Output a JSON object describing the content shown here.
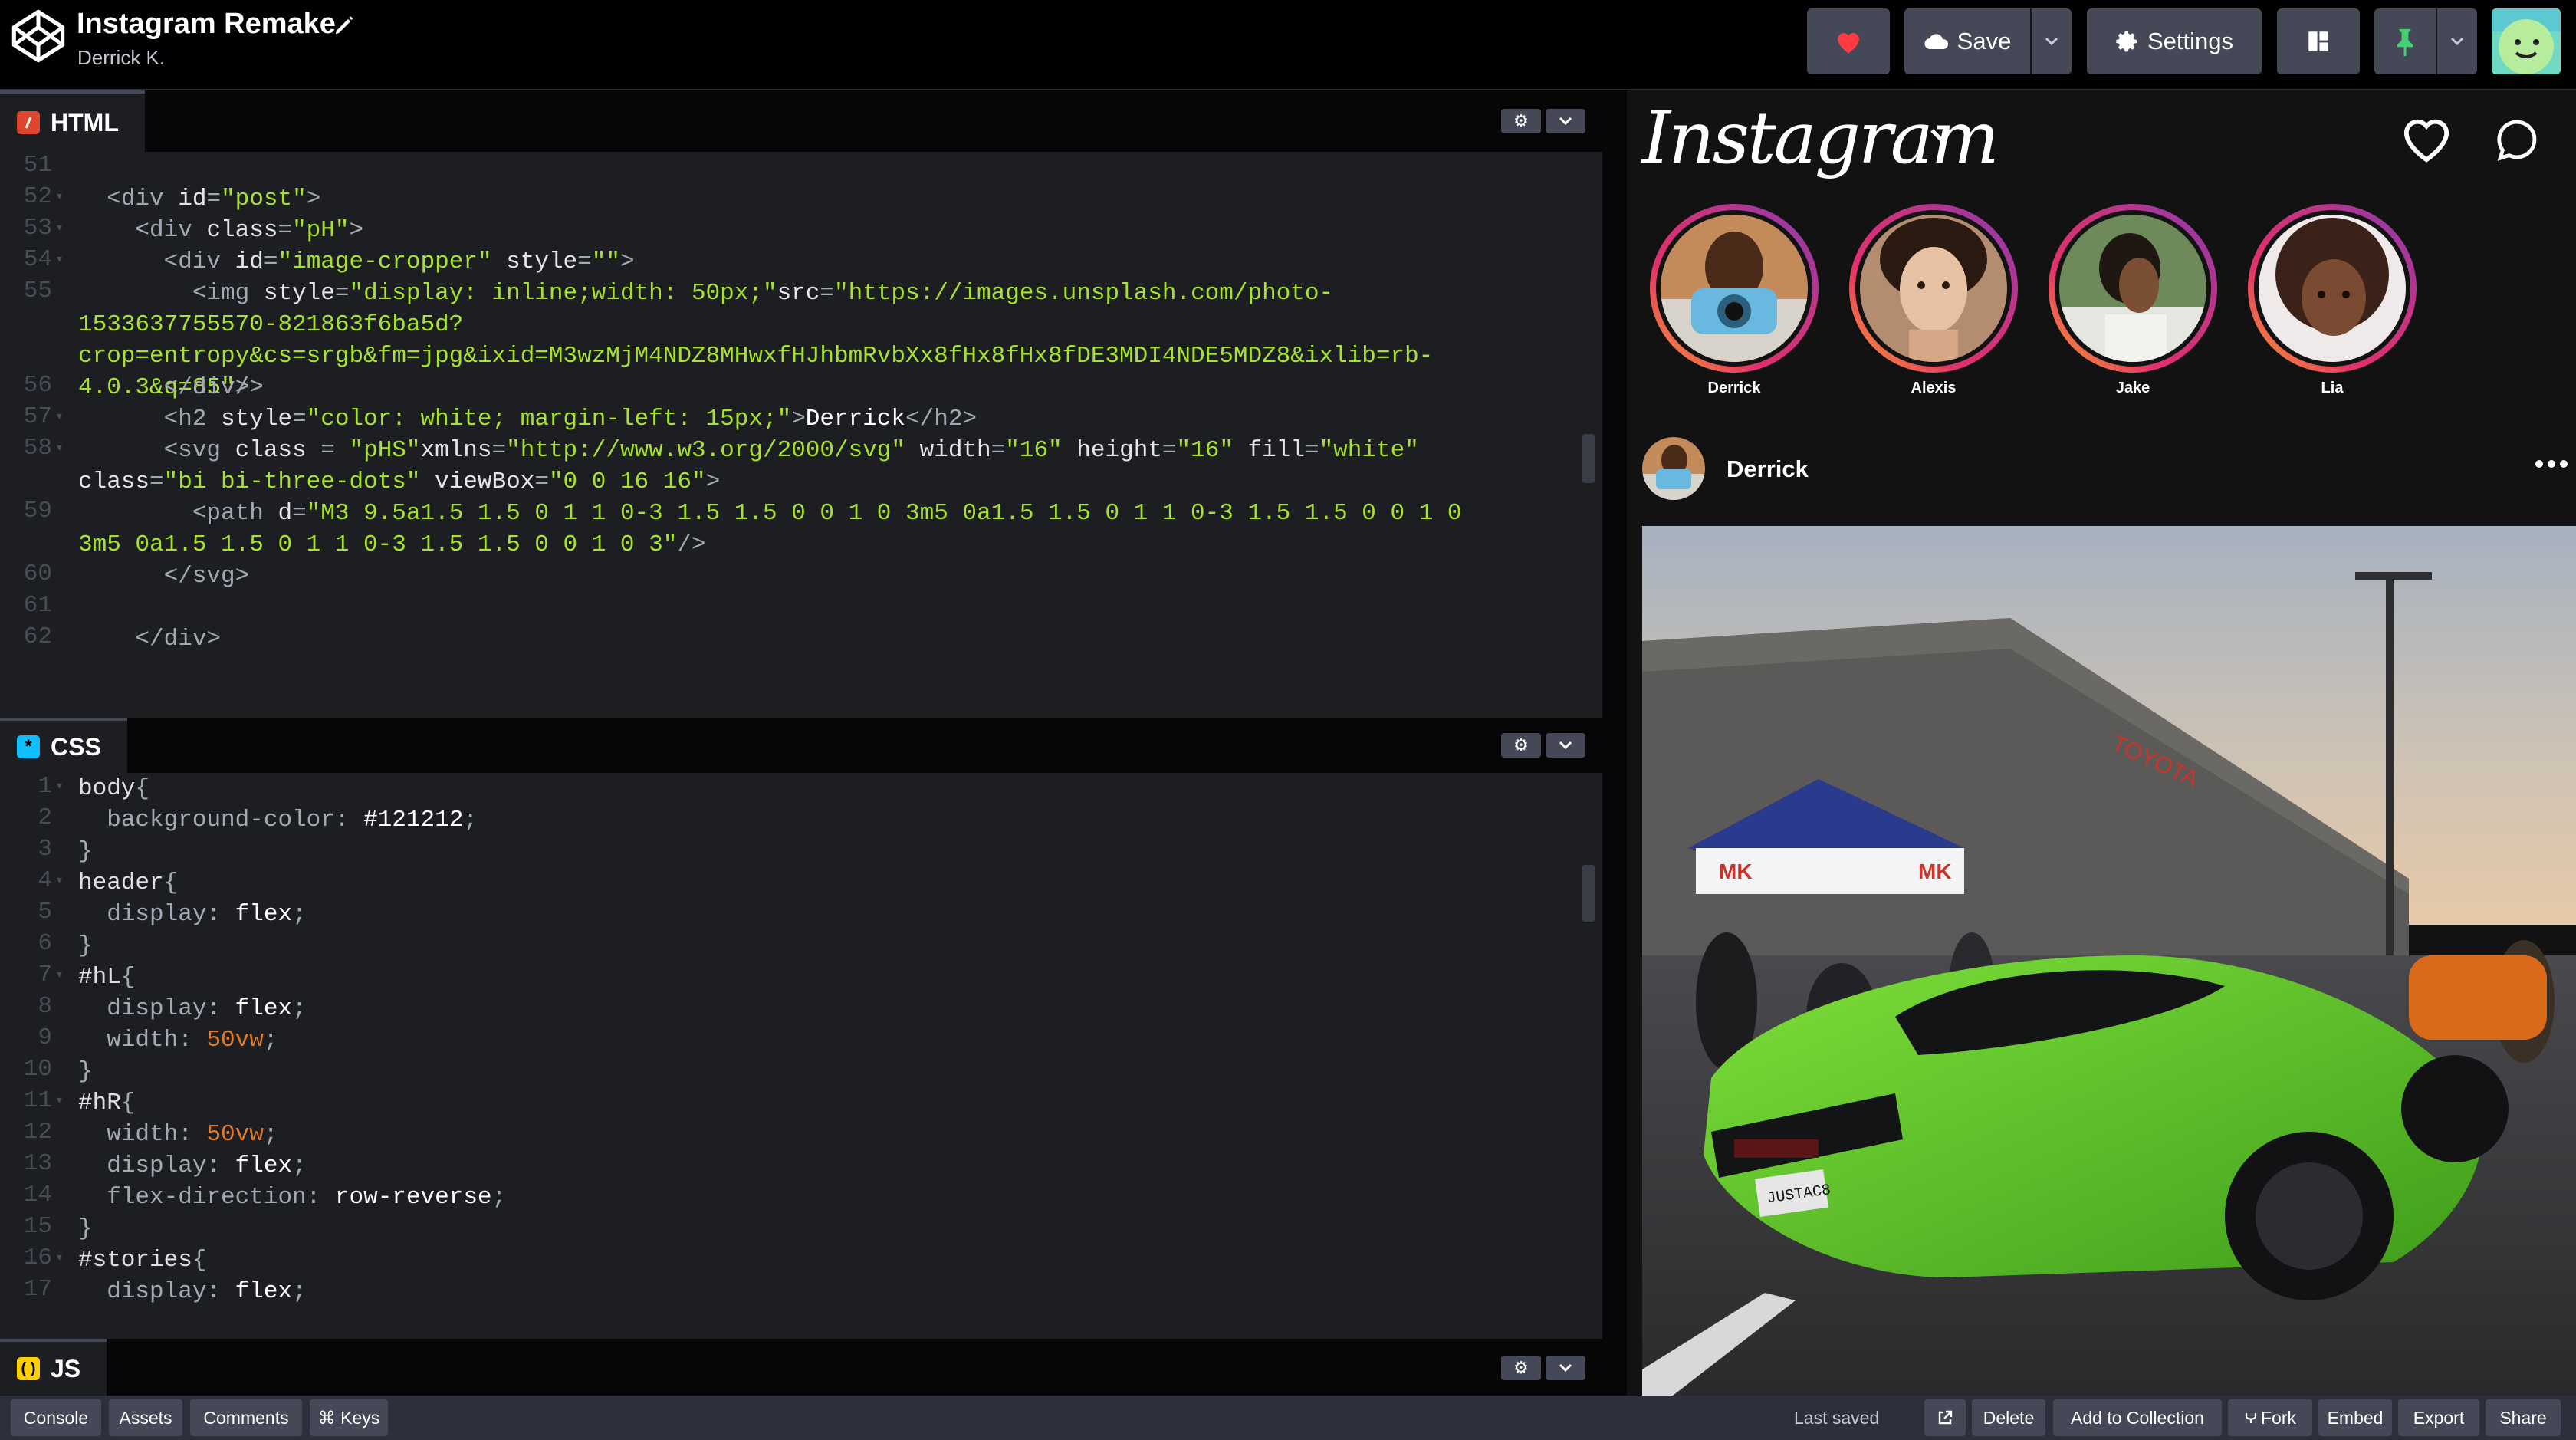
{
  "app": {
    "pen_title": "Instagram Remake",
    "author": "Derrick K."
  },
  "toolbar": {
    "save_label": "Save",
    "settings_label": "Settings"
  },
  "panels": {
    "html": {
      "label": "HTML"
    },
    "css": {
      "label": "CSS"
    },
    "js": {
      "label": "JS"
    }
  },
  "html_code": [
    {
      "n": "51",
      "fold": false,
      "html": ""
    },
    {
      "n": "52",
      "fold": true,
      "html": "  <span class='t-tag'>&lt;div</span> <span class='t-attr'>id</span>=<span class='t-val'>\"post\"</span><span class='t-tag'>&gt;</span>"
    },
    {
      "n": "53",
      "fold": true,
      "html": "    <span class='t-tag'>&lt;div</span> <span class='t-attr'>class</span>=<span class='t-val'>\"pH\"</span><span class='t-tag'>&gt;</span>"
    },
    {
      "n": "54",
      "fold": true,
      "html": "      <span class='t-tag'>&lt;div</span> <span class='t-attr'>id</span>=<span class='t-val'>\"image-cropper\"</span> <span class='t-attr'>style</span>=<span class='t-val'>\"\"</span><span class='t-tag'>&gt;</span>"
    },
    {
      "n": "55",
      "fold": false,
      "html": "        <span class='t-tag'>&lt;img</span> <span class='t-attr'>style</span>=<span class='t-val'>\"display: inline;width: 50px;\"</span><span class='t-attr'>src</span>=<span class='t-val'>\"https://images.unsplash.com/photo-1533637755570-821863f6ba5d?crop=entropy&amp;cs=srgb&amp;fm=jpg&amp;ixid=M3wzMjM4NDZ8MHwxfHJhbmRvbXx8fHx8fHx8fDE3MDI4NDE5MDZ8&amp;ixlib=rb-4.0.3&amp;q=85\"</span><span class='t-tag'>/&gt;</span>",
      "rows": 3
    },
    {
      "n": "56",
      "fold": false,
      "html": "      <span class='t-tag'>&lt;/div&gt;</span>"
    },
    {
      "n": "57",
      "fold": true,
      "html": "      <span class='t-tag'>&lt;h2</span> <span class='t-attr'>style</span>=<span class='t-val'>\"color: white; margin-left: 15px;\"</span><span class='t-tag'>&gt;</span><span class='t-plain'>Derrick</span><span class='t-tag'>&lt;/h2&gt;</span>"
    },
    {
      "n": "58",
      "fold": true,
      "html": "      <span class='t-tag'>&lt;svg</span> <span class='t-attr'>class</span> = <span class='t-val'>\"pHS\"</span><span class='t-attr'>xmlns</span>=<span class='t-val'>\"http://www.w3.org/2000/svg\"</span> <span class='t-attr'>width</span>=<span class='t-val'>\"16\"</span> <span class='t-attr'>height</span>=<span class='t-val'>\"16\"</span> <span class='t-attr'>fill</span>=<span class='t-val'>\"white\"</span> <span class='t-attr'>class</span>=<span class='t-val'>\"bi bi-three-dots\"</span> <span class='t-attr'>viewBox</span>=<span class='t-val'>\"0 0 16 16\"</span><span class='t-tag'>&gt;</span>",
      "rows": 2
    },
    {
      "n": "59",
      "fold": false,
      "html": "        <span class='t-tag'>&lt;path</span> <span class='t-attr'>d</span>=<span class='t-val'>\"M3 9.5a1.5 1.5 0 1 1 0-3 1.5 1.5 0 0 1 0 3m5 0a1.5 1.5 0 1 1 0-3 1.5 1.5 0 0 1 0 3m5 0a1.5 1.5 0 1 1 0-3 1.5 1.5 0 0 1 0 3\"</span><span class='t-tag'>/&gt;</span>",
      "rows": 2
    },
    {
      "n": "60",
      "fold": false,
      "html": "      <span class='t-tag'>&lt;/svg&gt;</span>"
    },
    {
      "n": "61",
      "fold": false,
      "html": ""
    },
    {
      "n": "62",
      "fold": false,
      "html": "    <span class='t-tag'>&lt;/div&gt;</span>"
    }
  ],
  "css_code": [
    {
      "n": "1",
      "fold": true,
      "html": "<span class='t-sel'>body</span>{"
    },
    {
      "n": "2",
      "fold": false,
      "html": "  <span class='t-prop'>background-color</span>: <span class='t-plain'>#121212</span>;"
    },
    {
      "n": "3",
      "fold": false,
      "html": "}"
    },
    {
      "n": "4",
      "fold": true,
      "html": "<span class='t-sel'>header</span>{"
    },
    {
      "n": "5",
      "fold": false,
      "html": "  <span class='t-prop'>display</span>: <span class='t-plain'>flex</span>;"
    },
    {
      "n": "6",
      "fold": false,
      "html": "}"
    },
    {
      "n": "7",
      "fold": true,
      "html": "<span class='t-sel'>#hL</span>{"
    },
    {
      "n": "8",
      "fold": false,
      "html": "  <span class='t-prop'>display</span>: <span class='t-plain'>flex</span>;"
    },
    {
      "n": "9",
      "fold": false,
      "html": "  <span class='t-prop'>width</span>: <span class='t-num'>50vw</span>;"
    },
    {
      "n": "10",
      "fold": false,
      "html": "}"
    },
    {
      "n": "11",
      "fold": true,
      "html": "<span class='t-sel'>#hR</span>{"
    },
    {
      "n": "12",
      "fold": false,
      "html": "  <span class='t-prop'>width</span>: <span class='t-num'>50vw</span>;"
    },
    {
      "n": "13",
      "fold": false,
      "html": "  <span class='t-prop'>display</span>: <span class='t-plain'>flex</span>;"
    },
    {
      "n": "14",
      "fold": false,
      "html": "  <span class='t-prop'>flex-direction</span>: <span class='t-plain'>row-reverse</span>;"
    },
    {
      "n": "15",
      "fold": false,
      "html": "}"
    },
    {
      "n": "16",
      "fold": true,
      "html": "<span class='t-sel'>#stories</span>{"
    },
    {
      "n": "17",
      "fold": false,
      "html": "  <span class='t-prop'>display</span>: <span class='t-plain'>flex</span>;"
    }
  ],
  "preview": {
    "logo_text": "Instagram",
    "stories": [
      {
        "name": "Derrick"
      },
      {
        "name": "Alexis"
      },
      {
        "name": "Jake"
      },
      {
        "name": "Lia"
      }
    ],
    "post": {
      "username": "Derrick",
      "plate": "JUSTAC8",
      "store_sign": "TOYOTA"
    }
  },
  "footer": {
    "console": "Console",
    "assets": "Assets",
    "comments": "Comments",
    "keys": "⌘ Keys",
    "last_saved": "Last saved",
    "delete": "Delete",
    "add_to_collection": "Add to Collection",
    "fork": "Fork",
    "embed": "Embed",
    "export": "Export",
    "share": "Share"
  }
}
